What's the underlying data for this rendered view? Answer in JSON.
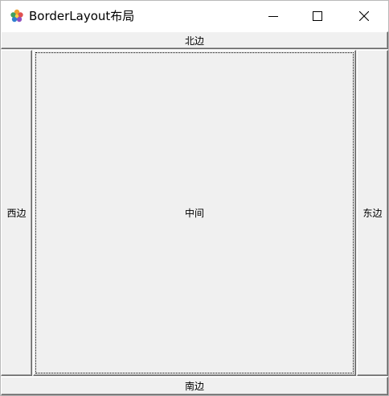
{
  "window": {
    "title": "BorderLayout布局",
    "icon": "java-app-icon",
    "controls": {
      "minimize": "minimize-icon",
      "maximize": "maximize-icon",
      "close": "close-icon"
    }
  },
  "buttons": {
    "north": "北边",
    "south": "南边",
    "west": "西边",
    "east": "东边",
    "center": "中间"
  }
}
